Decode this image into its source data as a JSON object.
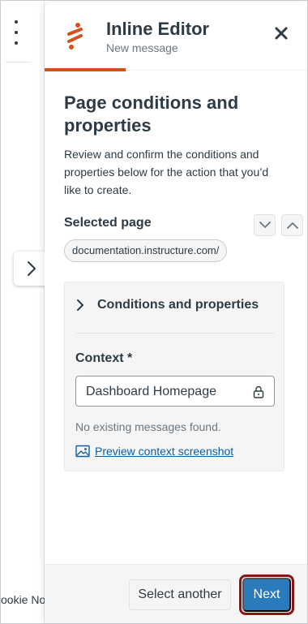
{
  "background": {
    "footer_text": "ookie No"
  },
  "panel": {
    "title": "Inline Editor",
    "subtitle": "New message",
    "accent_color": "#d4521a"
  },
  "content": {
    "heading": "Page conditions and properties",
    "description": "Review and confirm the conditions and properties below for the action that you’d like to create."
  },
  "selected_page": {
    "label": "Selected page",
    "url": "documentation.instructure.com/"
  },
  "conditions": {
    "toggle_label": "Conditions and properties",
    "context_label": "Context *",
    "context_value": "Dashboard Homepage",
    "no_messages": "No existing messages found.",
    "preview_link": "Preview context screenshot"
  },
  "footer": {
    "secondary_button": "Select another",
    "primary_button": "Next",
    "primary_color": "#2b7abc",
    "highlight_color": "#8b1414"
  },
  "icons": [
    "kebab-icon",
    "chevron-right-icon",
    "logo-icon",
    "close-icon",
    "chevron-down-icon",
    "chevron-up-icon",
    "lock-icon",
    "image-icon"
  ]
}
